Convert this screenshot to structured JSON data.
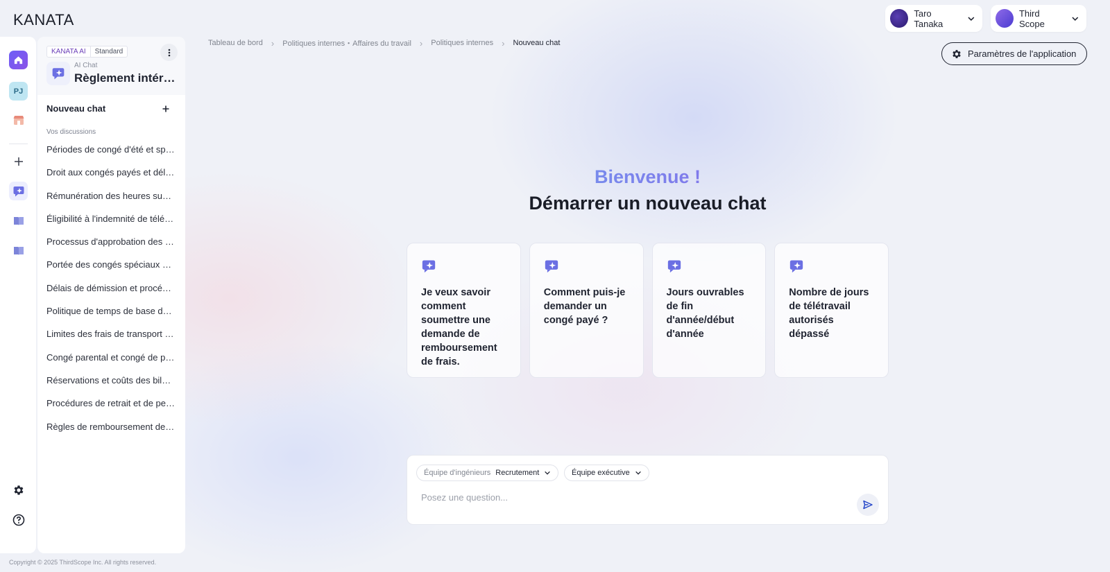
{
  "header": {
    "logo": "KANATA",
    "user_name": "Taro Tanaka",
    "org_name": "Third Scope"
  },
  "rail": {
    "project_initials": "PJ"
  },
  "sidebar": {
    "badge_ai": "KANATA AI",
    "badge_plan": "Standard",
    "app_subtitle": "AI Chat",
    "app_title": "Règlement intérieur",
    "new_chat_label": "Nouveau chat",
    "section_label": "Vos discussions",
    "conversations": [
      "Périodes de congé d'été et spéciaux",
      "Droit aux congés payés et délais",
      "Rémunération des heures supplémentaires",
      "Éligibilité à l'indemnité de télétravail",
      "Processus d'approbation des dépenses",
      "Portée des congés spéciaux et conditions",
      "Délais de démission et procédures",
      "Politique de temps de base de travail",
      "Limites des frais de transport et règles",
      "Congé parental et congé de paternité",
      "Réservations et coûts des bilans de santé",
      "Procédures de retrait et de pertes",
      "Règles de remboursement des frais"
    ]
  },
  "breadcrumb": {
    "items": [
      "Tableau de bord",
      "Politiques internes・Affaires du travail",
      "Politiques internes"
    ],
    "current": "Nouveau chat"
  },
  "main": {
    "settings_label": "Paramètres de l'application",
    "welcome": "Bienvenue !",
    "headline": "Démarrer un nouveau chat",
    "suggestions": [
      "Je veux savoir comment soumettre une demande de remboursement de frais.",
      "Comment puis-je demander un congé payé ?",
      "Jours ouvrables de fin d'année/début d'année",
      "Nombre de jours de télétravail autorisés dépassé"
    ]
  },
  "composer": {
    "chip1_prefix": "Équipe d'ingénieurs",
    "chip1_value": "Recrutement",
    "chip2_value": "Équipe exécutive",
    "placeholder": "Posez une question..."
  },
  "footer": {
    "copyright": "Copyright © 2025 ThirdScope Inc. All rights reserved."
  }
}
